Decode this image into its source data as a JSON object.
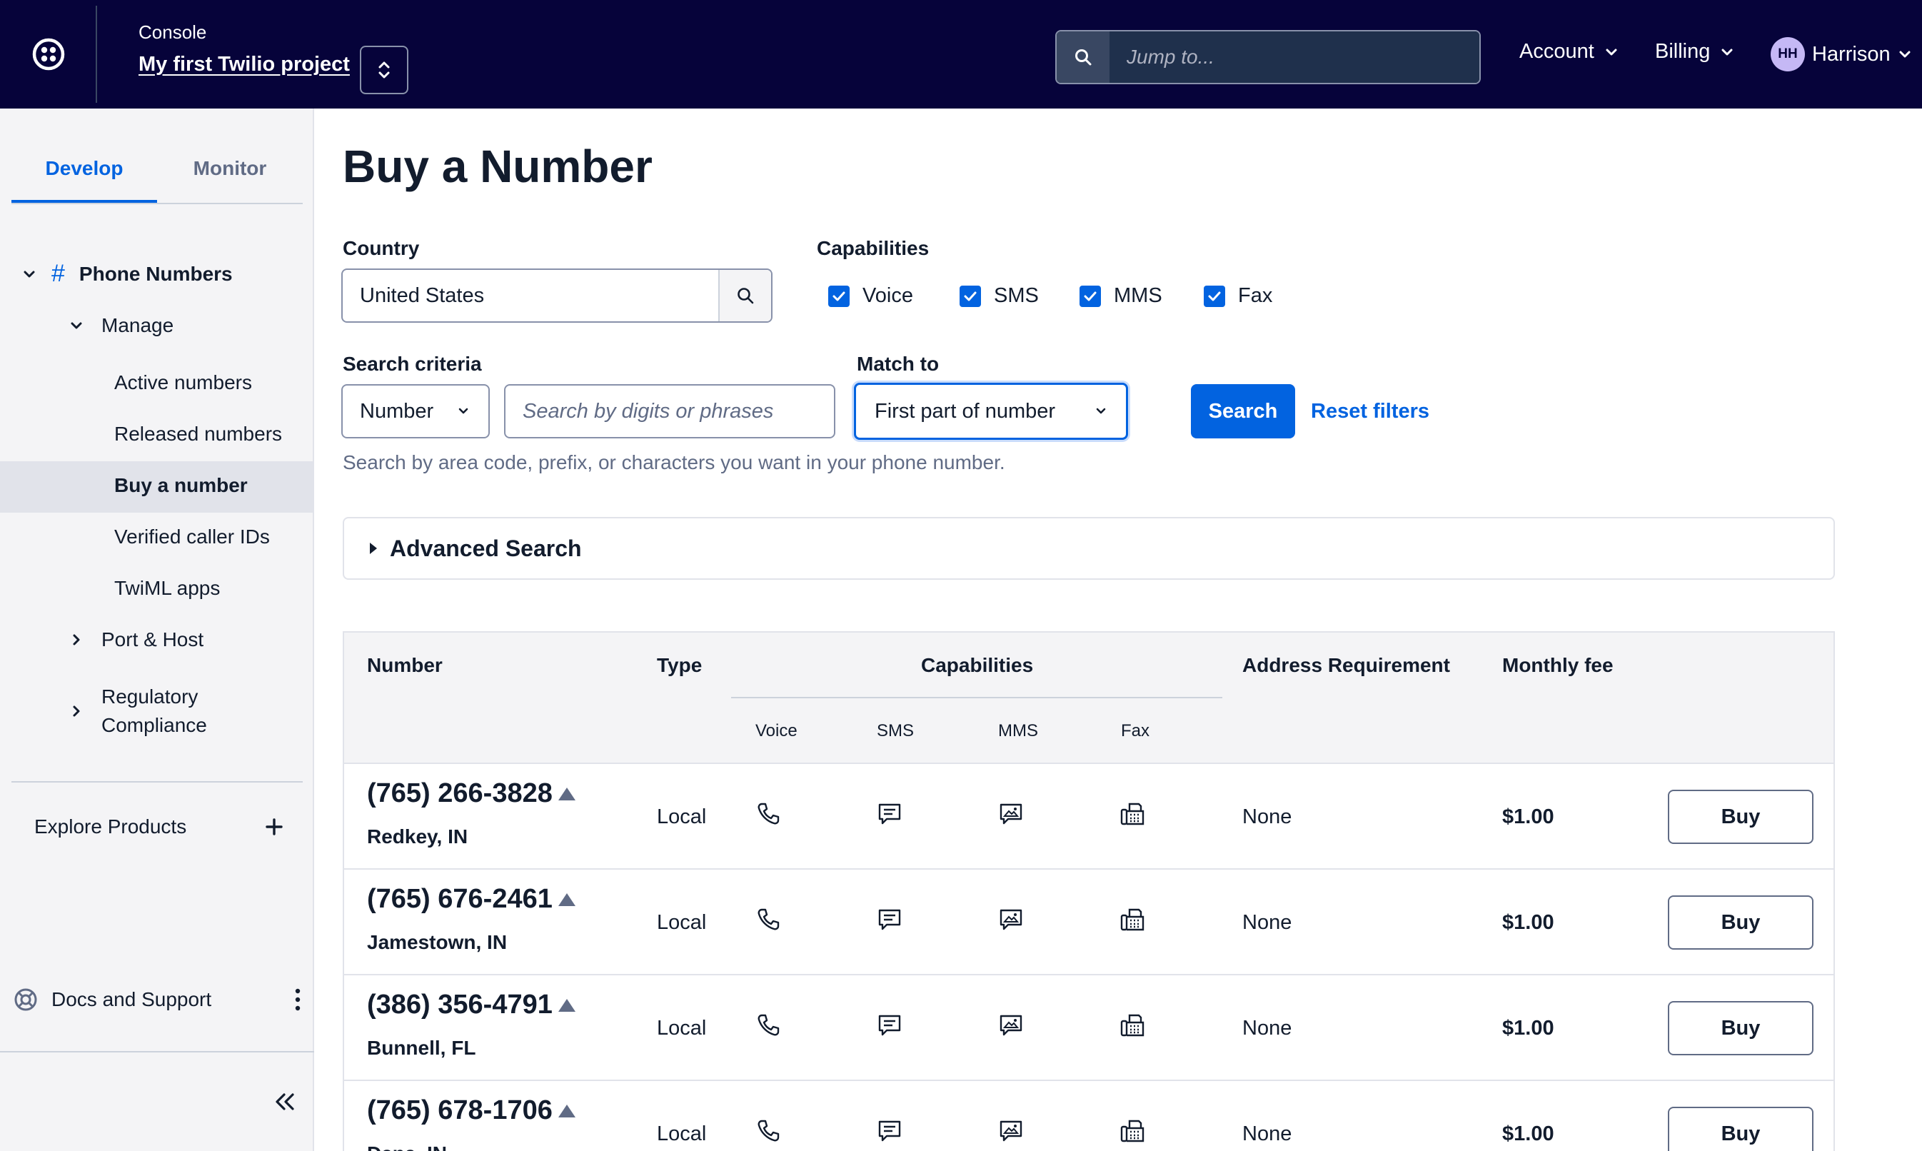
{
  "header": {
    "console_label": "Console",
    "project_name": "My first Twilio project",
    "search_placeholder": "Jump to...",
    "account_label": "Account",
    "billing_label": "Billing",
    "user_initials": "HH",
    "user_name": "Harrison"
  },
  "sidebar": {
    "tabs": [
      {
        "label": "Develop",
        "active": true
      },
      {
        "label": "Monitor",
        "active": false
      }
    ],
    "section": "Phone Numbers",
    "manage": "Manage",
    "items": [
      "Active numbers",
      "Released numbers",
      "Buy a number",
      "Verified caller IDs",
      "TwiML apps"
    ],
    "selected_item": "Buy a number",
    "port_host": "Port & Host",
    "regulatory_line1": "Regulatory",
    "regulatory_line2": "Compliance",
    "explore": "Explore Products",
    "docs": "Docs and Support"
  },
  "page": {
    "title": "Buy a Number",
    "country_label": "Country",
    "country_value": "United States",
    "capabilities_label": "Capabilities",
    "capabilities": [
      {
        "label": "Voice",
        "checked": true
      },
      {
        "label": "SMS",
        "checked": true
      },
      {
        "label": "MMS",
        "checked": true
      },
      {
        "label": "Fax",
        "checked": true
      }
    ],
    "criteria_label": "Search criteria",
    "criteria_value": "Number",
    "digits_placeholder": "Search by digits or phrases",
    "match_label": "Match to",
    "match_value": "First part of number",
    "search_button": "Search",
    "reset_link": "Reset filters",
    "help_text": "Search by area code, prefix, or characters you want in your phone number.",
    "advanced_search": "Advanced Search"
  },
  "table": {
    "headers": {
      "number": "Number",
      "type": "Type",
      "capabilities": "Capabilities",
      "address": "Address Requirement",
      "fee": "Monthly fee"
    },
    "sub_headers": [
      "Voice",
      "SMS",
      "MMS",
      "Fax"
    ],
    "rows": [
      {
        "number": "(765) 266-3828",
        "location": "Redkey, IN",
        "type": "Local",
        "address": "None",
        "fee": "$1.00",
        "action": "Buy"
      },
      {
        "number": "(765) 676-2461",
        "location": "Jamestown, IN",
        "type": "Local",
        "address": "None",
        "fee": "$1.00",
        "action": "Buy"
      },
      {
        "number": "(386) 356-4791",
        "location": "Bunnell, FL",
        "type": "Local",
        "address": "None",
        "fee": "$1.00",
        "action": "Buy"
      },
      {
        "number": "(765) 678-1706",
        "location": "Dana, IN",
        "type": "Local",
        "address": "None",
        "fee": "$1.00",
        "action": "Buy"
      }
    ]
  },
  "colors": {
    "topbar_bg": "#06033a",
    "accent": "#0263e0",
    "sidebar_bg": "#f4f4f6"
  },
  "icons": [
    "twilio-logo-icon",
    "switch-icon",
    "search-icon",
    "chevron-down-icon",
    "user-avatar",
    "hash-icon",
    "chevron-right-icon",
    "plus-icon",
    "lifebuoy-icon",
    "kebab-icon",
    "collapse-icon",
    "check-icon",
    "caret-right-icon",
    "phone-icon",
    "sms-icon",
    "mms-icon",
    "fax-icon",
    "triangle-icon"
  ]
}
